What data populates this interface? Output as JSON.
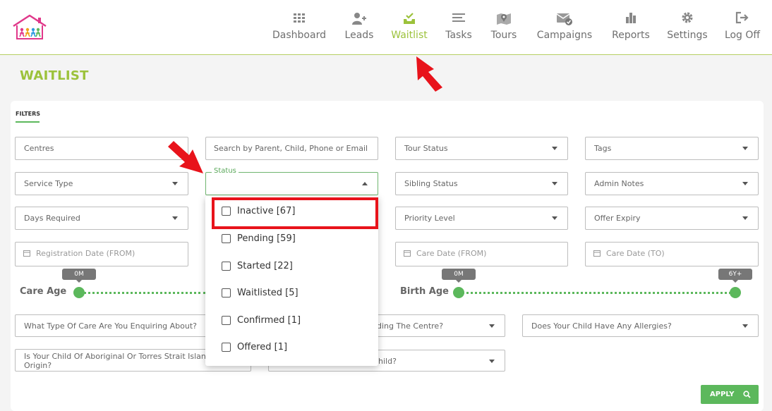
{
  "nav": {
    "items": [
      {
        "label": "Dashboard",
        "icon": "dashboard-grid-icon",
        "active": false
      },
      {
        "label": "Leads",
        "icon": "add-user-icon",
        "active": false
      },
      {
        "label": "Waitlist",
        "icon": "inbox-check-icon",
        "active": true
      },
      {
        "label": "Tasks",
        "icon": "list-icon",
        "active": false
      },
      {
        "label": "Tours",
        "icon": "map-pin-icon",
        "active": false
      },
      {
        "label": "Campaigns",
        "icon": "mail-check-icon",
        "active": false
      },
      {
        "label": "Reports",
        "icon": "bar-chart-icon",
        "active": false
      },
      {
        "label": "Settings",
        "icon": "gear-icon",
        "active": false
      },
      {
        "label": "Log Off",
        "icon": "logout-icon",
        "active": false
      }
    ]
  },
  "page": {
    "title": "WAITLIST"
  },
  "filters": {
    "title": "FILTERS",
    "centres": "Centres",
    "search_placeholder": "Search by Parent, Child, Phone or Email",
    "tour_status": "Tour Status",
    "tags": "Tags",
    "service_type": "Service Type",
    "status_label": "Status",
    "sibling_status": "Sibling Status",
    "admin_notes": "Admin Notes",
    "days_required": "Days Required",
    "priority_level": "Priority Level",
    "offer_expiry": "Offer Expiry",
    "registration_from": "Registration Date (FROM)",
    "care_from": "Care Date (FROM)",
    "care_to": "Care Date (TO)",
    "care_age": {
      "label": "Care Age",
      "min_label": "0M"
    },
    "birth_age": {
      "label": "Birth Age",
      "min_label": "0M",
      "max_label": "6Y+"
    },
    "care_type_question": "What Type Of Care Are You Enquiring About?",
    "attending_question_fragment": "nding The Centre?",
    "allergies_question": "Does Your Child Have Any Allergies?",
    "aboriginal_question": "Is Your Child Of Aboriginal Or Torres Strait Islander Origin?",
    "child_question_fragment": "hild?",
    "apply_label": "APPLY"
  },
  "status_dropdown": {
    "options": [
      {
        "label": "Inactive [67]",
        "checked": false,
        "highlighted": true
      },
      {
        "label": "Pending [59]",
        "checked": false,
        "highlighted": false
      },
      {
        "label": "Started [22]",
        "checked": false,
        "highlighted": false
      },
      {
        "label": "Waitlisted [5]",
        "checked": false,
        "highlighted": false
      },
      {
        "label": "Confirmed [1]",
        "checked": false,
        "highlighted": false
      },
      {
        "label": "Offered [1]",
        "checked": false,
        "highlighted": false
      }
    ]
  },
  "colors": {
    "brand_green": "#9cc23b",
    "accent_green": "#5cb85c",
    "annotation_red": "#e8131b",
    "logo_pink": "#e0388a"
  }
}
